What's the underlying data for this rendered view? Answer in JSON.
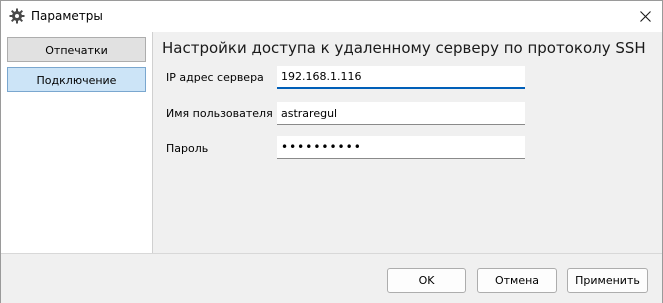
{
  "window": {
    "title": "Параметры"
  },
  "sidebar": {
    "items": [
      {
        "label": "Отпечатки",
        "active": false
      },
      {
        "label": "Подключение",
        "active": true
      }
    ]
  },
  "main": {
    "heading": "Настройки доступа к удаленному серверу по протоколу SSH",
    "fields": [
      {
        "label": "IP адрес сервера",
        "value": "192.168.1.116"
      },
      {
        "label": "Имя пользователя",
        "value": "astraregul"
      },
      {
        "label": "Пароль",
        "value": "••••••••••"
      }
    ]
  },
  "footer": {
    "ok_label": "OK",
    "cancel_label": "Отмена",
    "apply_label": "Применить"
  },
  "colors": {
    "accent": "#005fb8",
    "active_tab": "#cce4f7"
  },
  "icons": {
    "app": "gear-icon",
    "close": "close-icon"
  }
}
